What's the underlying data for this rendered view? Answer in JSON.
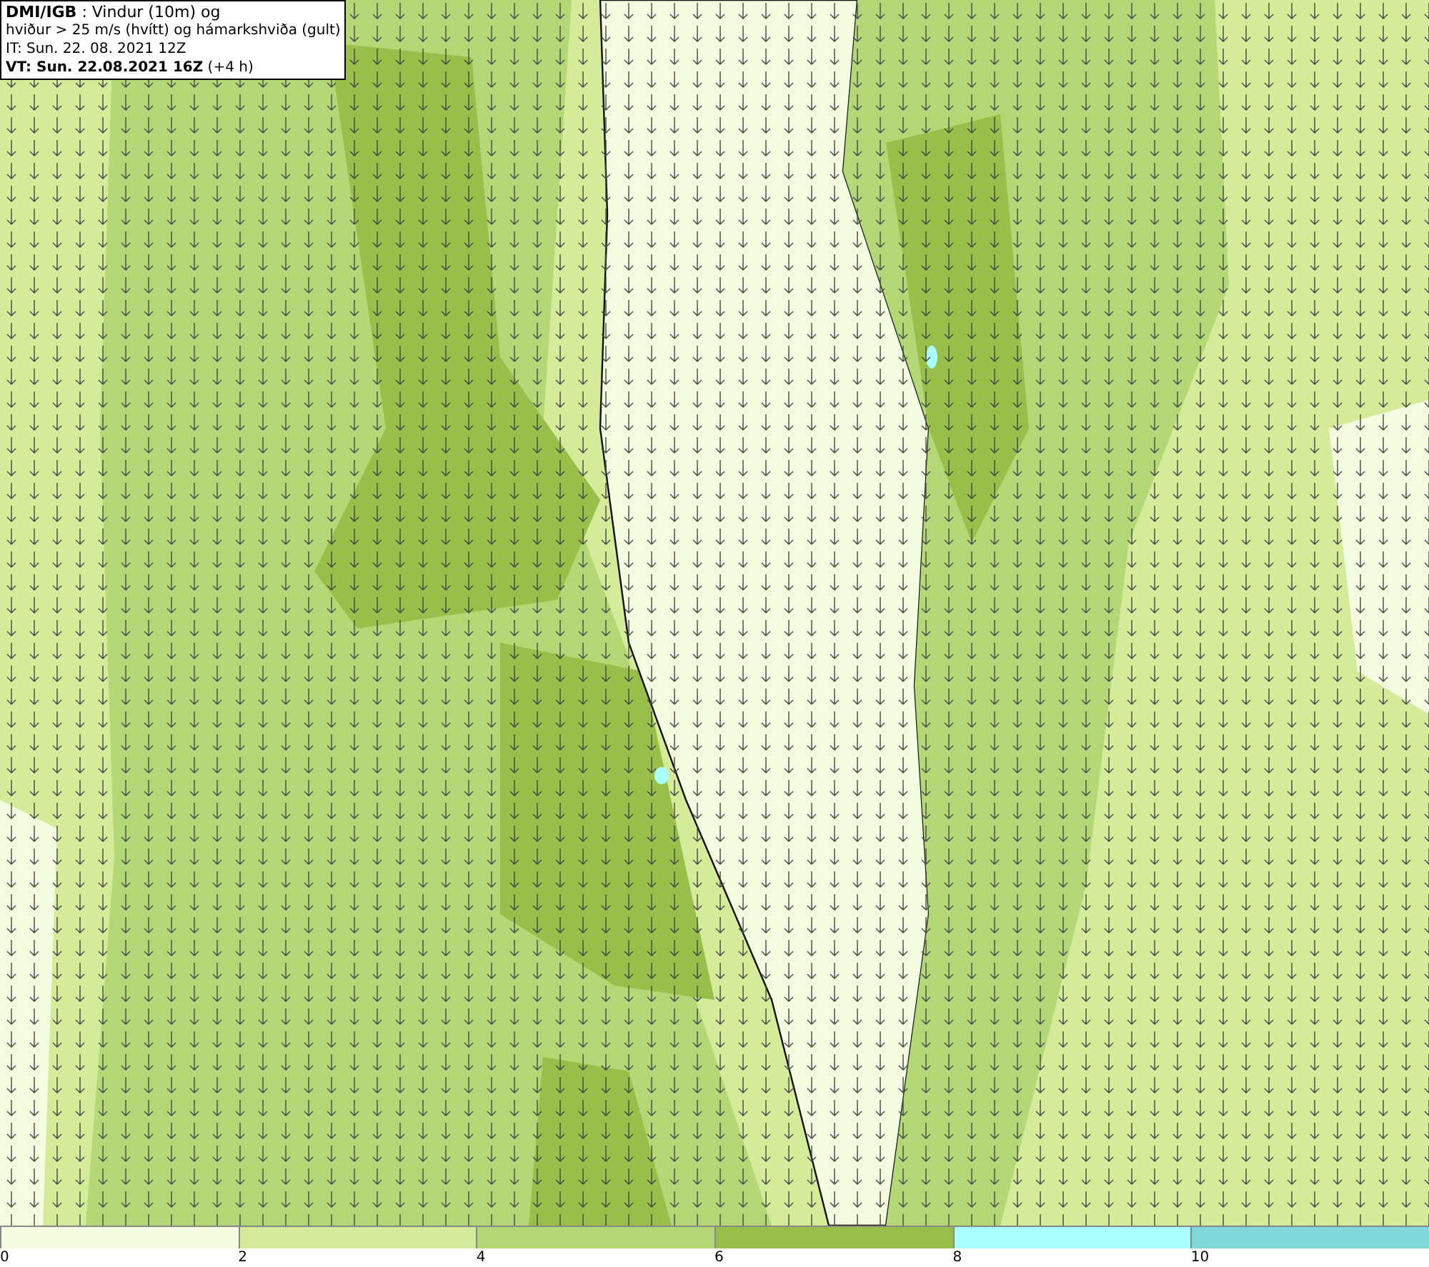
{
  "legend_box": {
    "lines": [
      "**DMI/IGB** : Vindur (10m) og",
      "hviður > 25 m/s (hvítt) og hámarkshviða (gult)",
      "IT: Sun. 22. 08. 2021 12Z",
      "**VT: Sun. 22.08.2021 16Z** (+4 h)"
    ]
  },
  "colorbar": {
    "segments": [
      {
        "color": "#f5fde0"
      },
      {
        "color": "#d4ec9a"
      },
      {
        "color": "#b5d876"
      },
      {
        "color": "#98bf4a"
      },
      {
        "color": "#aaffff"
      },
      {
        "color": "#7fd8d8"
      }
    ],
    "ticks": [
      "0",
      "2",
      "4",
      "6",
      "8",
      "10"
    ]
  }
}
